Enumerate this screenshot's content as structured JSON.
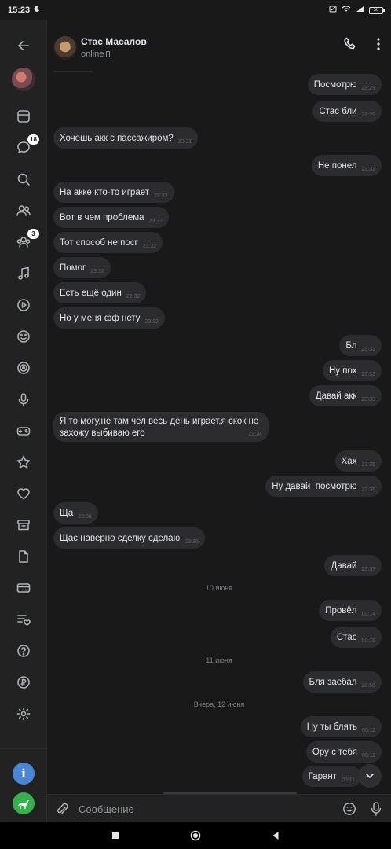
{
  "status_bar": {
    "time": "15:23",
    "battery": "56"
  },
  "sidebar": {
    "items": [
      {
        "icon": "back-arrow-icon",
        "badge": ""
      },
      {
        "icon": "profile-avatar",
        "badge": ""
      },
      {
        "icon": "newsfeed-icon",
        "badge": ""
      },
      {
        "icon": "messages-icon",
        "badge": "18"
      },
      {
        "icon": "search-icon",
        "badge": ""
      },
      {
        "icon": "friends-icon",
        "badge": ""
      },
      {
        "icon": "communities-icon",
        "badge": "3"
      },
      {
        "icon": "music-icon",
        "badge": ""
      },
      {
        "icon": "video-icon",
        "badge": ""
      },
      {
        "icon": "stickers-icon",
        "badge": ""
      },
      {
        "icon": "clips-icon",
        "badge": ""
      },
      {
        "icon": "podcasts-icon",
        "badge": ""
      },
      {
        "icon": "games-icon",
        "badge": ""
      },
      {
        "icon": "bookmarks-icon",
        "badge": ""
      },
      {
        "icon": "likes-icon",
        "badge": ""
      },
      {
        "icon": "archive-icon",
        "badge": ""
      },
      {
        "icon": "documents-icon",
        "badge": ""
      },
      {
        "icon": "payments-icon",
        "badge": ""
      },
      {
        "icon": "wishlist-icon",
        "badge": ""
      },
      {
        "icon": "help-icon",
        "badge": ""
      },
      {
        "icon": "money-icon",
        "badge": ""
      },
      {
        "icon": "settings-icon",
        "badge": ""
      }
    ],
    "info_label": "i"
  },
  "header": {
    "name": "Стас Масалов",
    "status": "online"
  },
  "messages": [
    {
      "dir": "out",
      "text": "Посмотрю",
      "time": "23:29"
    },
    {
      "dir": "out",
      "text": "Стас бли",
      "time": "23:29"
    },
    {
      "dir": "in",
      "text": "Хочешь акк с пассажиром?",
      "time": "23:31"
    },
    {
      "dir": "out",
      "text": "Не понел",
      "time": "23:32"
    },
    {
      "dir": "in",
      "text": "На акке кто-то играет",
      "time": "23:32"
    },
    {
      "dir": "in",
      "text": "Вот в чем проблема",
      "time": "23:32"
    },
    {
      "dir": "in",
      "text": "Тот способ не посг",
      "time": "23:32"
    },
    {
      "dir": "in",
      "text": "Помог",
      "time": "23:32"
    },
    {
      "dir": "in",
      "text": "Есть ещё один",
      "time": "23:32"
    },
    {
      "dir": "in",
      "text": "Но у меня фф нету",
      "time": "23:32"
    },
    {
      "dir": "out",
      "text": "Бл",
      "time": "23:32"
    },
    {
      "dir": "out",
      "text": "Ну пох",
      "time": "23:32"
    },
    {
      "dir": "out",
      "text": "Давай акк",
      "time": "23:33"
    },
    {
      "dir": "in",
      "text": "Я то могу,не там чел весь день играет,я скок не захожу выбиваю его",
      "time": "23:34"
    },
    {
      "dir": "out",
      "text": "Хах",
      "time": "23:35"
    },
    {
      "dir": "out",
      "text": "Ну давай  посмотрю",
      "time": "23:35"
    },
    {
      "dir": "in",
      "text": "Ща",
      "time": "23:36"
    },
    {
      "dir": "in",
      "text": "Щас наверно сделку сделаю",
      "time": "23:36"
    },
    {
      "dir": "out",
      "text": "Давай",
      "time": "23:37"
    },
    {
      "dir": "out",
      "text": "Провёл",
      "time": "00:14"
    },
    {
      "dir": "out",
      "text": "Стас",
      "time": "00:15"
    },
    {
      "dir": "out",
      "text": "Бля заебал",
      "time": "20:50"
    },
    {
      "dir": "out",
      "text": "Ну ты блять",
      "time": "00:11"
    },
    {
      "dir": "out",
      "text": "Ору с тебя",
      "time": "00:11"
    },
    {
      "dir": "out",
      "text": "Гарант",
      "time": "00:11"
    }
  ],
  "date_separators": [
    "10 июня",
    "11 июня",
    "Вчера, 12 июня"
  ],
  "composer": {
    "placeholder": "Сообщение"
  }
}
